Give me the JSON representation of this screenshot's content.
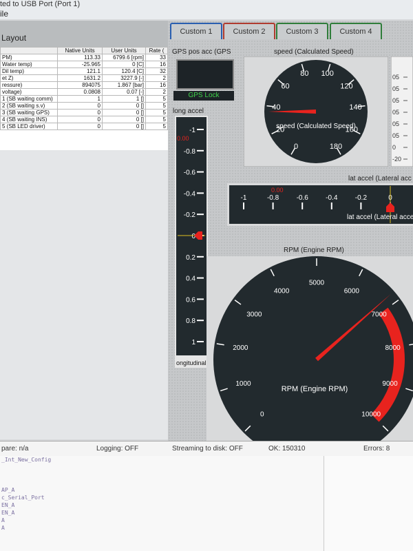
{
  "window": {
    "title": "ted to USB Port (Port 1)",
    "menu_first": "ile"
  },
  "layout_panel": {
    "title": "Layout"
  },
  "table": {
    "headers": [
      "",
      "Native Units",
      "User Units",
      "Rate ("
    ],
    "rows": [
      [
        "PM)",
        "113.33",
        "6799.6 [rpm]",
        "33"
      ],
      [
        "Water temp)",
        "-25.965",
        "0 [C]",
        "16"
      ],
      [
        "Dil temp)",
        "121.1",
        "120.4 [C]",
        "32"
      ],
      [
        "et Z)",
        "1631.2",
        "3227.9 [-]",
        "2"
      ],
      [
        "ressure)",
        "894075",
        "1.867 [bar]",
        "16"
      ],
      [
        "voltage)",
        "0.0808",
        "0.07 [-]",
        "2"
      ],
      [
        "1 (SB waiting comm)",
        "1",
        "1 []",
        "5"
      ],
      [
        "2 (SB waiting s.v)",
        "0",
        "0 []",
        "5"
      ],
      [
        "3 (SB waiting GPS)",
        "0",
        "0 []",
        "5"
      ],
      [
        "4 (SB waiting INS)",
        "0",
        "0 []",
        "5"
      ],
      [
        "5 (SB LED driver)",
        "0",
        "0 []",
        "5"
      ]
    ]
  },
  "tabs": [
    "Custom 1",
    "Custom 2",
    "Custom 3",
    "Custom 4"
  ],
  "gps": {
    "title": "GPS pos acc (GPS",
    "lock": "GPS Lock"
  },
  "long_accel": {
    "title": "long accel",
    "ticks": [
      "-1",
      "-0.8",
      "-0.6",
      "-0.4",
      "-0.2",
      "0",
      "0.2",
      "0.4",
      "0.6",
      "0.8",
      "1"
    ],
    "overlay_value": "0.00",
    "footer": "ongitudinal",
    "value": 0
  },
  "speed_gauge": {
    "title": "speed (Calculated Speed)",
    "ticks": [
      "0",
      "20",
      "40",
      "60",
      "80",
      "100",
      "120",
      "140",
      "160",
      "180"
    ],
    "center_label": "speed (Calculated Speed)",
    "value": 36
  },
  "lat_accel": {
    "title": "lat accel (Lateral acc",
    "ticks": [
      "-1",
      "-0.8",
      "-0.6",
      "-0.4",
      "-0.2",
      "0"
    ],
    "overlay_value": "0.00",
    "footer": "lat accel (Lateral acce",
    "value": 0
  },
  "side_strip": {
    "ticks": [
      "05",
      "05",
      "05",
      "05",
      "05",
      "05",
      "0",
      "-20"
    ]
  },
  "rpm_gauge": {
    "title": "RPM (Engine RPM)",
    "ticks": [
      "0",
      "1000",
      "2000",
      "3000",
      "4000",
      "5000",
      "6000",
      "7000",
      "8000",
      "9000",
      "10000"
    ],
    "center_label": "RPM (Engine RPM)",
    "redline_from": 7000,
    "value": 6800
  },
  "status": {
    "left": "pare: n/a",
    "logging": "Logging: OFF",
    "streaming": "Streaming to disk: OFF",
    "ok": "OK: 150310",
    "errors": "Errors: 8"
  },
  "console_lines": [
    "_Int_New_Config",
    "",
    "",
    "",
    "AP_A",
    "c_Serial_Port",
    "EN_A",
    "EN_A",
    "A",
    "A"
  ],
  "colors": {
    "needle": "#e8231e",
    "gauge_face": "#222a2e",
    "lock_text": "#3fd24a"
  }
}
